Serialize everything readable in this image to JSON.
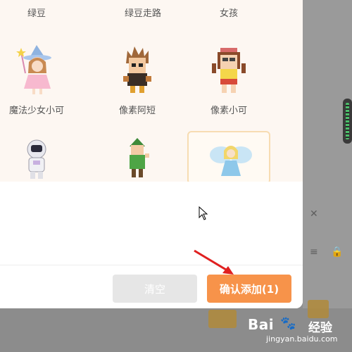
{
  "grid": {
    "row1": [
      "绿豆",
      "绿豆走路",
      "女孩"
    ],
    "row2": [
      "魔法少女小可",
      "像素阿短",
      "像素小可"
    ],
    "row3_icons": [
      "astronaut-avatar",
      "elf-avatar",
      "fairy-avatar"
    ]
  },
  "footer": {
    "clear_label": "清空",
    "confirm_label": "确认添加(1)"
  },
  "watermark": {
    "brand": "Bai",
    "brand2": "经验",
    "url": "jingyan.baidu.com"
  },
  "colors": {
    "accent": "#f7934a",
    "disabled": "#e6e6e6",
    "grid_bg": "#fdf7f2",
    "selected_border": "#f7dcb2",
    "annotation_arrow": "#e02020"
  }
}
